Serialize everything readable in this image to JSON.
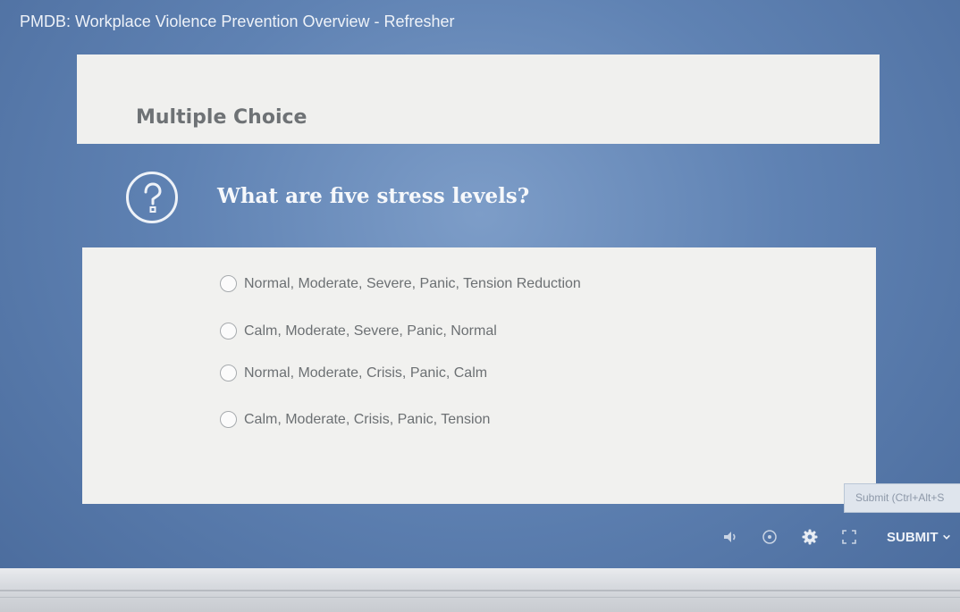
{
  "course": {
    "title": "PMDB: Workplace Violence Prevention Overview - Refresher"
  },
  "header": {
    "label": "Multiple Choice"
  },
  "question": {
    "icon": "question-mark-icon",
    "text": "What are five stress levels?"
  },
  "options": [
    {
      "label": "Normal, Moderate, Severe, Panic, Tension Reduction"
    },
    {
      "label": "Calm, Moderate, Severe, Panic, Normal"
    },
    {
      "label": "Normal, Moderate, Crisis, Panic, Calm"
    },
    {
      "label": "Calm, Moderate, Crisis, Panic, Tension"
    }
  ],
  "tooltip": {
    "text": "Submit (Ctrl+Alt+S"
  },
  "toolbar": {
    "icons": [
      "volume-icon",
      "captions-icon",
      "settings-gear-icon",
      "fullscreen-icon"
    ],
    "submit_label": "SUBMIT"
  },
  "colors": {
    "background": "#5f82b3",
    "card": "#f0f0ee",
    "question_text": "#f6f8fb",
    "option_text": "#6c7073"
  }
}
